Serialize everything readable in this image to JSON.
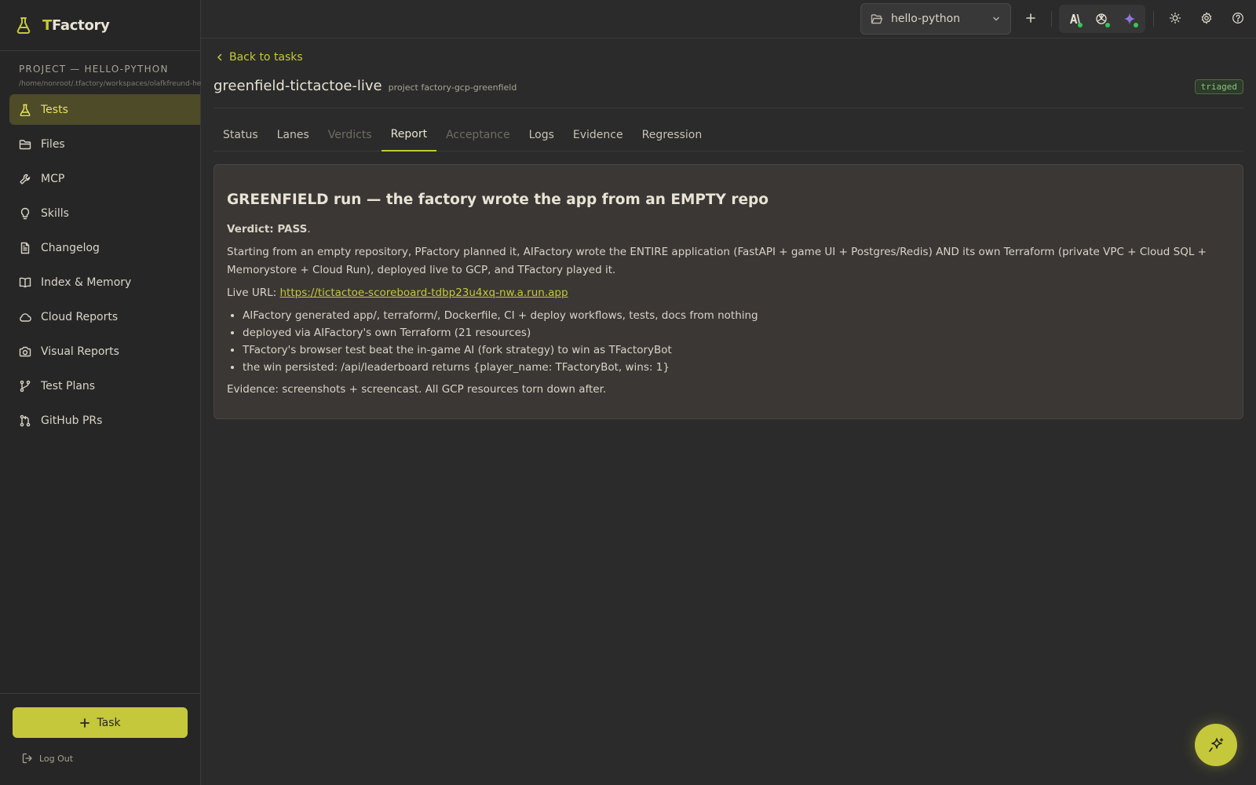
{
  "brand": {
    "first_letter": "T",
    "rest": "Factory"
  },
  "project": {
    "title": "PROJECT — HELLO-PYTHON",
    "path": "/home/nonroot/.tfactory/workspaces/olafkfreund-hello-python"
  },
  "sidebar": {
    "items": [
      {
        "label": "Tests",
        "icon": "flask-icon",
        "active": true
      },
      {
        "label": "Files",
        "icon": "folder-icon"
      },
      {
        "label": "MCP",
        "icon": "wrench-icon"
      },
      {
        "label": "Skills",
        "icon": "lightbulb-icon"
      },
      {
        "label": "Changelog",
        "icon": "document-icon"
      },
      {
        "label": "Index & Memory",
        "icon": "book-icon"
      },
      {
        "label": "Cloud Reports",
        "icon": "cloud-icon"
      },
      {
        "label": "Visual Reports",
        "icon": "camera-icon"
      },
      {
        "label": "Test Plans",
        "icon": "git-fork-icon"
      },
      {
        "label": "GitHub PRs",
        "icon": "git-pull-request-icon"
      }
    ],
    "task_button": "Task",
    "logout": "Log Out"
  },
  "topbar": {
    "project_select": "hello-python"
  },
  "task": {
    "back": "Back to tasks",
    "title": "greenfield-tictactoe-live",
    "subtitle": "project factory-gcp-greenfield",
    "status": "triaged"
  },
  "tabs": [
    {
      "label": "Status"
    },
    {
      "label": "Lanes"
    },
    {
      "label": "Verdicts",
      "disabled": true
    },
    {
      "label": "Report",
      "active": true
    },
    {
      "label": "Acceptance",
      "disabled": true
    },
    {
      "label": "Logs"
    },
    {
      "label": "Evidence"
    },
    {
      "label": "Regression"
    }
  ],
  "report": {
    "heading": "GREENFIELD run — the factory wrote the app from an EMPTY repo",
    "verdict_label": "Verdict: PASS",
    "verdict_suffix": ".",
    "intro": "Starting from an empty repository, PFactory planned it, AIFactory wrote the ENTIRE application (FastAPI + game UI + Postgres/Redis) AND its own Terraform (private VPC + Cloud SQL + Memorystore + Cloud Run), deployed live to GCP, and TFactory played it.",
    "live_label": "Live URL: ",
    "live_url": "https://tictactoe-scoreboard-tdbp23u4xq-nw.a.run.app",
    "bullets": [
      "AIFactory generated app/, terraform/, Dockerfile, CI + deploy workflows, tests, docs from nothing",
      "deployed via AIFactory's own Terraform (21 resources)",
      "TFactory's browser test beat the in-game AI (fork strategy) to win as TFactoryBot",
      "the win persisted: /api/leaderboard returns {player_name: TFactoryBot, wins: 1}"
    ],
    "evidence": "Evidence: screenshots + screencast. All GCP resources torn down after."
  },
  "colors": {
    "accent": "#c5c83a",
    "background": "#2b2b2b",
    "sidebar": "#262626",
    "status_green": "#8ac27a"
  }
}
